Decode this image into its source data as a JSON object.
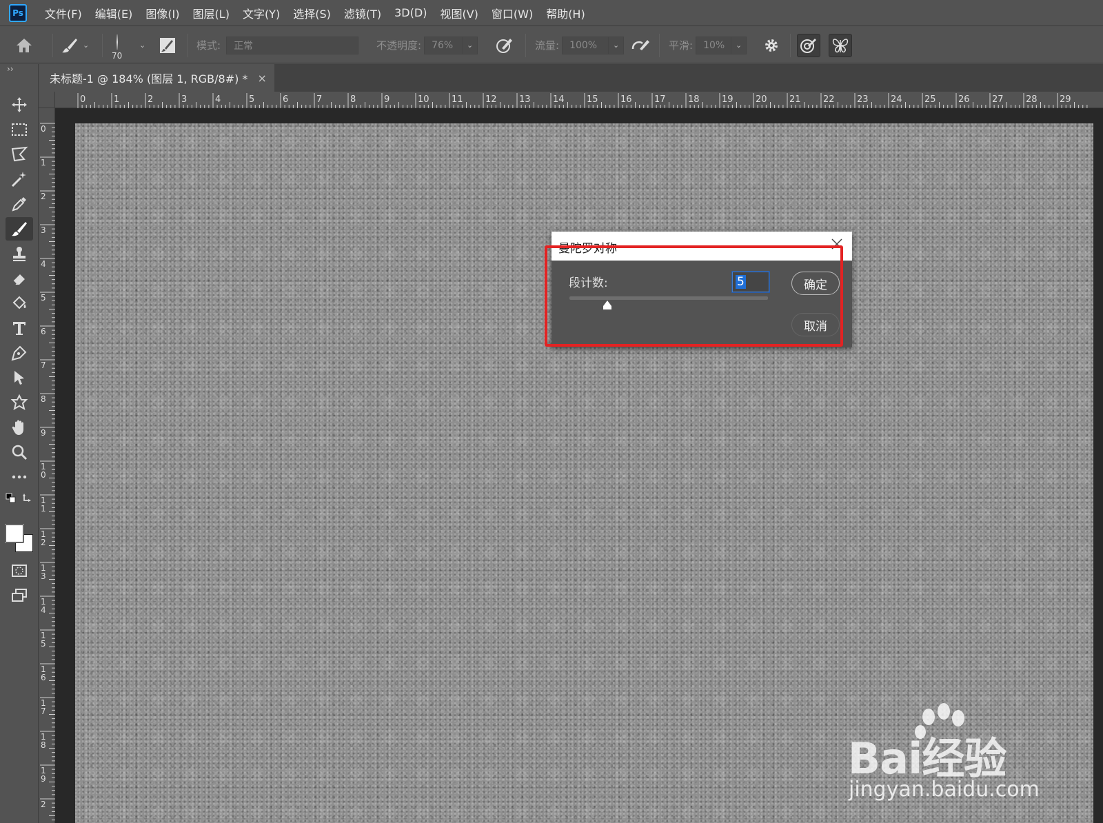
{
  "app": {
    "logo_text": "Ps"
  },
  "menu": [
    "文件(F)",
    "编辑(E)",
    "图像(I)",
    "图层(L)",
    "文字(Y)",
    "选择(S)",
    "滤镜(T)",
    "3D(D)",
    "视图(V)",
    "窗口(W)",
    "帮助(H)"
  ],
  "options": {
    "brush_size": "70",
    "mode_label": "模式:",
    "mode_value": "正常",
    "opacity_label": "不透明度:",
    "opacity_value": "76%",
    "flow_label": "流量:",
    "flow_value": "100%",
    "smoothing_label": "平滑:",
    "smoothing_value": "10%"
  },
  "toolbar_collapse": "››",
  "document": {
    "tab_title": "未标题-1 @ 184% (图层 1, RGB/8#) *",
    "close_glyph": "×"
  },
  "ruler": {
    "top": [
      "0",
      "1",
      "2",
      "3",
      "4",
      "5",
      "6",
      "7",
      "8",
      "9",
      "10",
      "11",
      "12",
      "13",
      "14",
      "15",
      "16",
      "17",
      "18",
      "19",
      "20",
      "21",
      "22",
      "23",
      "24",
      "25",
      "26",
      "27",
      "28",
      "29"
    ],
    "left": [
      "0",
      "1",
      "2",
      "3",
      "4",
      "5",
      "6",
      "7",
      "8",
      "9",
      "1\n0",
      "1\n1",
      "1\n2",
      "1\n3",
      "1\n4",
      "1\n5",
      "1\n6",
      "1\n7",
      "1\n8",
      "1\n9",
      "2"
    ]
  },
  "dialog": {
    "title": "曼陀罗对称",
    "segments_label": "段计数:",
    "segments_value": "5",
    "segments_slider_fraction": 0.19,
    "ok_label": "确定",
    "cancel_label": "取消"
  },
  "watermark": {
    "brand": "Bai经验",
    "url": "jingyan.baidu.com"
  },
  "colors": {
    "highlight": "#e32323",
    "ps_blue": "#31a8ff",
    "selection": "#1f6fd8"
  }
}
